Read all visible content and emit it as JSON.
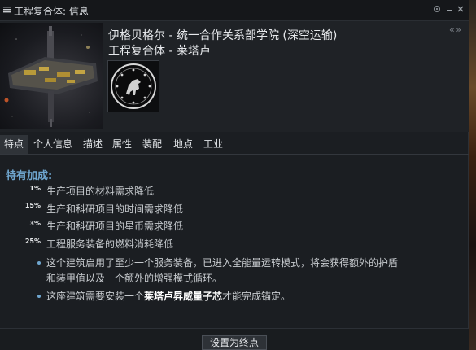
{
  "window": {
    "title": "工程复合体: 信息",
    "controls": [
      "gear-icon",
      "minimize-icon",
      "close-icon"
    ]
  },
  "header": {
    "corporation": "伊格贝格尔 - 统一合作关系部学院 (深空运输)",
    "structure": "工程复合体 - 莱塔卢",
    "collapse_glyph": "« »"
  },
  "tabs": [
    {
      "label": "特点",
      "active": true
    },
    {
      "label": "个人信息"
    },
    {
      "label": "描述"
    },
    {
      "label": "属性"
    },
    {
      "label": "装配"
    },
    {
      "label": "地点"
    },
    {
      "label": "工业"
    }
  ],
  "traits": {
    "section_title": "特有加成:",
    "bonuses": [
      {
        "percent": "1%",
        "text": "生产项目的材料需求降低"
      },
      {
        "percent": "15%",
        "text": "生产和科研项目的时间需求降低"
      },
      {
        "percent": "3%",
        "text": "生产和科研项目的星币需求降低"
      },
      {
        "percent": "25%",
        "text": "工程服务装备的燃料消耗降低"
      }
    ],
    "notes": [
      {
        "line1": "这个建筑启用了至少一个服务装备，已进入全能量运转模式，将会获得额外的护盾",
        "line2": "和装甲值以及一个额外的增强模式循环。"
      },
      {
        "before": "这座建筑需要安装一个",
        "strong": "莱塔卢昇威量子芯",
        "after": "才能完成锚定。"
      }
    ]
  },
  "footer": {
    "button_label": "设置为终点"
  },
  "colors": {
    "accent": "#6fa6cf",
    "window_bg": "#1b1e22",
    "text": "#c7cbcf"
  }
}
